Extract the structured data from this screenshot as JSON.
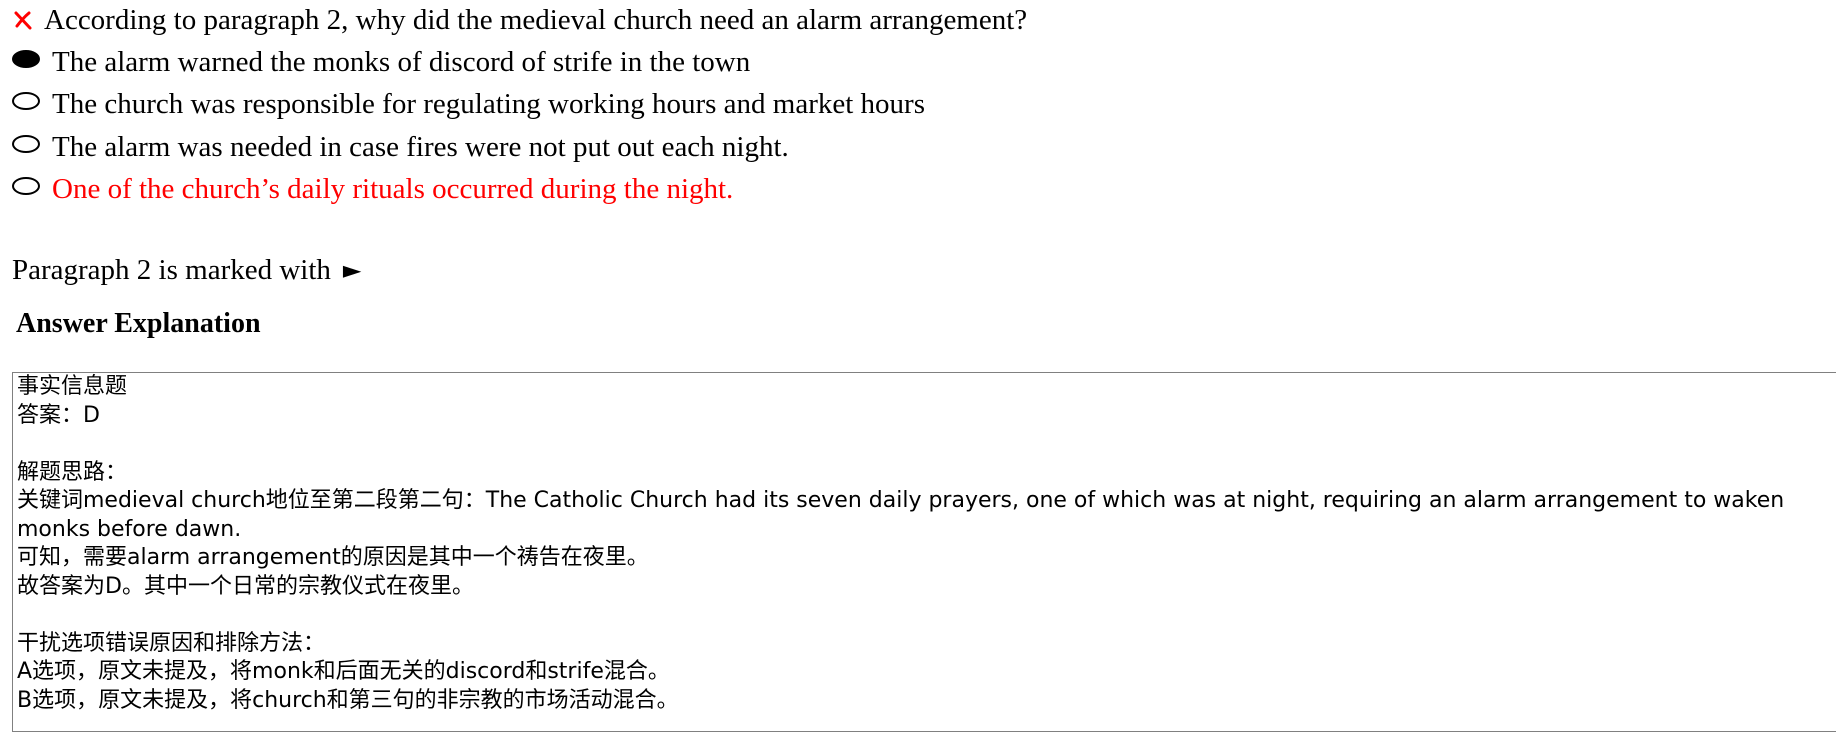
{
  "question": {
    "status_icon": "wrong-x-icon",
    "status_color": "#ff0000",
    "text": "According to paragraph 2, why did the medieval church need an alarm arrangement?"
  },
  "options": [
    {
      "text": "The alarm warned the monks of discord of strife in the town",
      "selected": true,
      "correct": false
    },
    {
      "text": "The church was responsible for regulating working hours and market hours",
      "selected": false,
      "correct": false
    },
    {
      "text": "The alarm was needed in case fires were not put out each night.",
      "selected": false,
      "correct": false
    },
    {
      "text": "One of the church’s daily rituals occurred during the night.",
      "selected": false,
      "correct": true
    }
  ],
  "correct_color": "#ff0000",
  "paragraph_note": {
    "text": "Paragraph 2 is marked with",
    "symbol": "►"
  },
  "explanation": {
    "heading": "Answer Explanation",
    "lines": [
      "事实信息题",
      "答案：D",
      "",
      "解题思路：",
      "关键词medieval church地位至第二段第二句：The Catholic Church had its seven daily prayers, one of which was at night, requiring an alarm arrangement to waken monks before dawn.",
      "可知，需要alarm arrangement的原因是其中一个祷告在夜里。",
      "故答案为D。其中一个日常的宗教仪式在夜里。",
      "",
      "干扰选项错误原因和排除方法：",
      "A选项，原文未提及，将monk和后面无关的discord和strife混合。",
      "B选项，原文未提及，将church和第三句的非宗教的市场活动混合。"
    ]
  }
}
